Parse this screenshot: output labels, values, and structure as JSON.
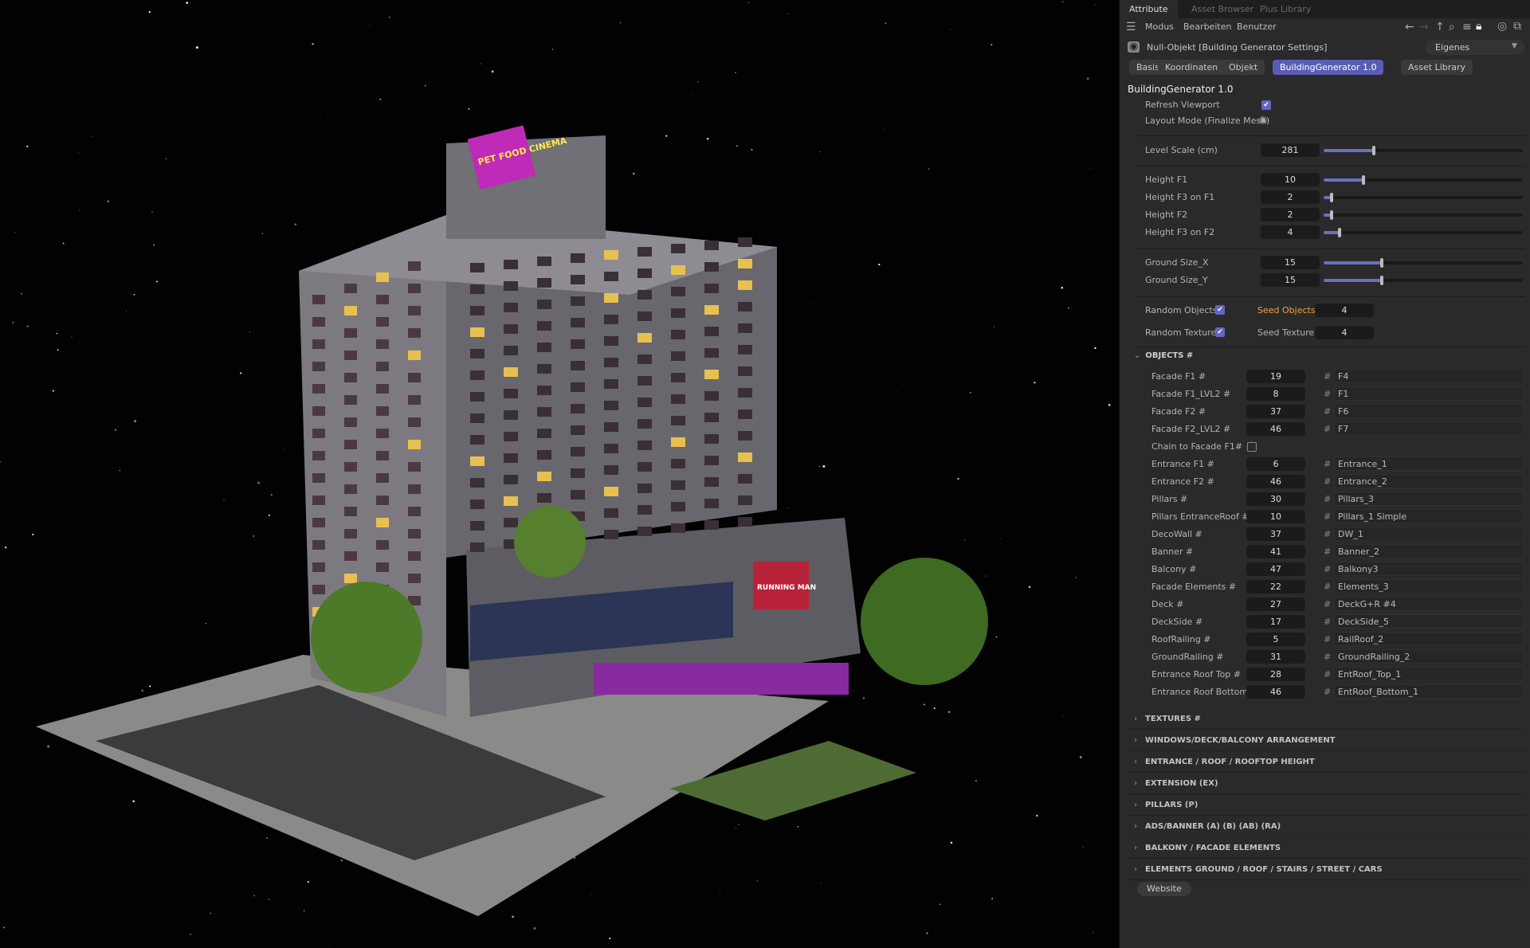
{
  "window_tabs": [
    {
      "label": "Attribute",
      "active": true
    },
    {
      "label": "Asset Browser",
      "active": false
    },
    {
      "label": "Plus Library",
      "active": false
    }
  ],
  "menu": {
    "items": [
      "Modus",
      "Bearbeiten",
      "Benutzer"
    ]
  },
  "object": {
    "title": "Null-Objekt [Building Generator Settings]",
    "preset": "Eigenes"
  },
  "tabs": [
    {
      "label": "Basis",
      "active": false
    },
    {
      "label": "Koordinaten",
      "active": false
    },
    {
      "label": "Objekt",
      "active": false
    },
    {
      "label": "BuildingGenerator 1.0",
      "active": true
    },
    {
      "label": "Asset Library",
      "active": false
    }
  ],
  "group_title": "BuildingGenerator 1.0",
  "refresh_viewport": {
    "label": "Refresh Viewport",
    "checked": true
  },
  "layout_mode": {
    "label": "Layout Mode (Finalize Mesh)"
  },
  "sliders": [
    {
      "label": "Level Scale (cm)",
      "value": "281",
      "fraction": 0.25
    },
    {
      "label": "Height F1",
      "value": "10",
      "fraction": 0.2
    },
    {
      "label": "Height F3 on F1",
      "value": "2",
      "fraction": 0.04
    },
    {
      "label": "Height F2",
      "value": "2",
      "fraction": 0.04
    },
    {
      "label": "Height F3 on F2",
      "value": "4",
      "fraction": 0.08
    },
    {
      "label": "Ground Size_X",
      "value": "15",
      "fraction": 0.29
    },
    {
      "label": "Ground Size_Y",
      "value": "15",
      "fraction": 0.29
    }
  ],
  "random": [
    {
      "label": "Random Objects",
      "checked": true,
      "seed_label": "Seed Objects",
      "seed_value": "4",
      "highlight": true
    },
    {
      "label": "Random Textures",
      "checked": true,
      "seed_label": "Seed Textures",
      "seed_value": "4",
      "highlight": false
    }
  ],
  "objects_section": {
    "title": "OBJECTS #",
    "rows": [
      {
        "label": "Facade F1 #",
        "value": "19",
        "name": "F4"
      },
      {
        "label": "Facade F1_LVL2 #",
        "value": "8",
        "name": "F1"
      },
      {
        "label": "Facade F2 #",
        "value": "37",
        "name": "F6"
      },
      {
        "label": "Facade F2_LVL2 #",
        "value": "46",
        "name": "F7"
      },
      {
        "label": "Chain to Facade F1#",
        "checkbox": true,
        "checked": false
      },
      {
        "label": "Entrance F1 #",
        "value": "6",
        "name": "Entrance_1"
      },
      {
        "label": "Entrance F2 #",
        "value": "46",
        "name": "Entrance_2"
      },
      {
        "label": "Pillars #",
        "value": "30",
        "name": "Pillars_3"
      },
      {
        "label": "Pillars EntranceRoof #",
        "value": "10",
        "name": "Pillars_1 Simple"
      },
      {
        "label": "DecoWall #",
        "value": "37",
        "name": "DW_1"
      },
      {
        "label": "Banner #",
        "value": "41",
        "name": "Banner_2"
      },
      {
        "label": "Balcony #",
        "value": "47",
        "name": "Balkony3"
      },
      {
        "label": "Facade Elements #",
        "value": "22",
        "name": "Elements_3"
      },
      {
        "label": "Deck #",
        "value": "27",
        "name": "DeckG+R #4"
      },
      {
        "label": "DeckSide #",
        "value": "17",
        "name": "DeckSide_5"
      },
      {
        "label": "RoofRailing #",
        "value": "5",
        "name": "RailRoof_2"
      },
      {
        "label": "GroundRailing #",
        "value": "31",
        "name": "GroundRailing_2"
      },
      {
        "label": "Entrance Roof Top #",
        "value": "28",
        "name": "EntRoof_Top_1"
      },
      {
        "label": "Entrance Roof Bottom#",
        "value": "46",
        "name": "EntRoof_Bottom_1"
      }
    ]
  },
  "hash_symbol": "#",
  "collapsed_sections": [
    "TEXTURES #",
    "WINDOWS/DECK/BALCONY ARRANGEMENT",
    "ENTRANCE / ROOF / ROOFTOP HEIGHT",
    "EXTENSION (EX)",
    "PILLARS (P)",
    "ADS/BANNER (A) (B) (AB) (RA)",
    "BALKONY / FACADE ELEMENTS",
    "ELEMENTS GROUND / ROOF / STAIRS / STREET / CARS"
  ],
  "website_button": "Website",
  "viewport_signs": [
    "PET FOOD CINEMA",
    "RUNNING MAN"
  ],
  "colors": {
    "accent": "#5a5db4",
    "seed_highlight": "#f0a040",
    "panel_bg": "#2a2a2a"
  }
}
